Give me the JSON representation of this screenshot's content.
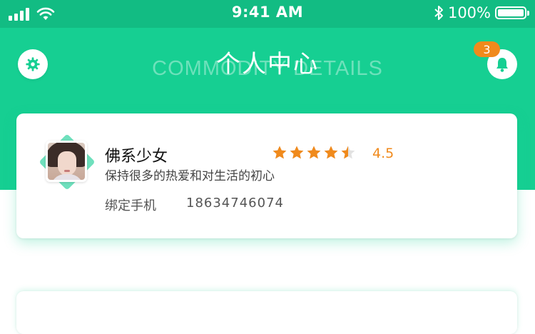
{
  "status_bar": {
    "time": "9:41 AM",
    "battery": "100%",
    "battery_level": 1.0
  },
  "header": {
    "title": "个人中心",
    "ghost_title": "COMMODITY DETAILS",
    "notification_count": "3",
    "settings_icon": "gear-icon",
    "bell_icon": "bell-icon"
  },
  "profile": {
    "name": "佛系少女",
    "motto": "保持很多的热爱和对生活的初心",
    "rating": "4.5",
    "rating_value": 4.5,
    "rating_max": 5,
    "phone_label": "绑定手机",
    "phone": "18634746074"
  },
  "colors": {
    "primary": "#16cf92",
    "status_bar": "#12bc83",
    "accent": "#f08a1c"
  }
}
